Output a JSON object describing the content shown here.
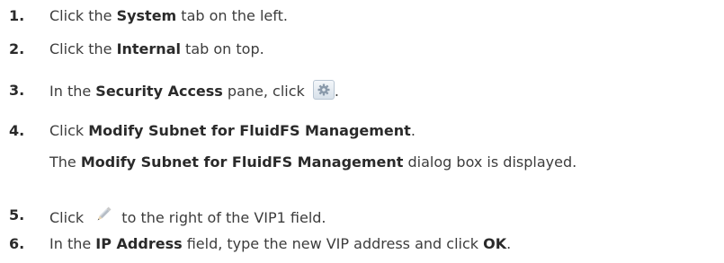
{
  "steps": [
    {
      "number": "1.",
      "pre": "Click the ",
      "bold": "System",
      "post": " tab on the left."
    },
    {
      "number": "2.",
      "pre": "Click the ",
      "bold": "Internal",
      "post": " tab on top."
    },
    {
      "number": "3.",
      "pre": "In the ",
      "bold": "Security Access",
      "post": " pane, click ",
      "icon": "gear-icon",
      "end": "."
    },
    {
      "number": "4.",
      "pre": "Click ",
      "bold": "Modify Subnet for FluidFS Management",
      "post": "."
    },
    {
      "number": "5.",
      "pre": "Click ",
      "icon": "pencil-icon",
      "post": " to the right of the VIP1 field."
    },
    {
      "number": "6.",
      "pre": "In the ",
      "bold": "IP Address",
      "post": " field, type the new VIP address and click ",
      "bold2": "OK",
      "end": "."
    }
  ],
  "step4_note": {
    "pre": "The ",
    "bold": "Modify Subnet for FluidFS Management",
    "post": " dialog box is displayed."
  }
}
